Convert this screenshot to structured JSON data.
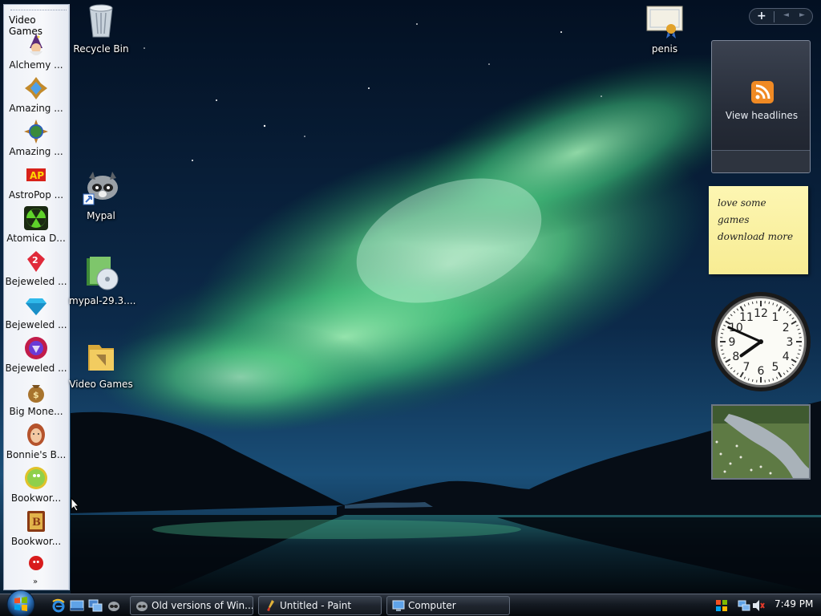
{
  "toolbar": {
    "title": "Video Games",
    "more": "»",
    "items": [
      {
        "label": "Alchemy ..."
      },
      {
        "label": "Amazing ..."
      },
      {
        "label": "Amazing ..."
      },
      {
        "label": "AstroPop ..."
      },
      {
        "label": "Atomica D..."
      },
      {
        "label": "Bejeweled ..."
      },
      {
        "label": "Bejeweled ..."
      },
      {
        "label": "Bejeweled ..."
      },
      {
        "label": "Big Mone..."
      },
      {
        "label": "Bonnie's B..."
      },
      {
        "label": "Bookwor..."
      },
      {
        "label": "Bookwor..."
      }
    ]
  },
  "desktop": {
    "icons": [
      {
        "label": "Recycle Bin"
      },
      {
        "label": "Mypal"
      },
      {
        "label": "mypal-29.3...."
      },
      {
        "label": "Video Games"
      },
      {
        "label": "penis"
      }
    ]
  },
  "sidebar": {
    "add": "+",
    "prev": "◄",
    "next": "►",
    "feed_label": "View headlines",
    "note_lines": [
      "love some",
      "games",
      "download more"
    ],
    "clock_numbers": [
      "12",
      "1",
      "2",
      "3",
      "4",
      "5",
      "6",
      "7",
      "8",
      "9",
      "10",
      "11"
    ],
    "clock_time": {
      "hours": 7,
      "minutes": 49
    }
  },
  "taskbar": {
    "buttons": [
      {
        "label": "Old versions of Win..."
      },
      {
        "label": "Untitled - Paint"
      },
      {
        "label": "Computer"
      }
    ],
    "time": "7:49 PM"
  },
  "colors": {
    "aurora": "#5ee28a",
    "sky_dark": "#061425",
    "note_yellow": "#fbf1a4",
    "taskbar": "#141a22"
  }
}
